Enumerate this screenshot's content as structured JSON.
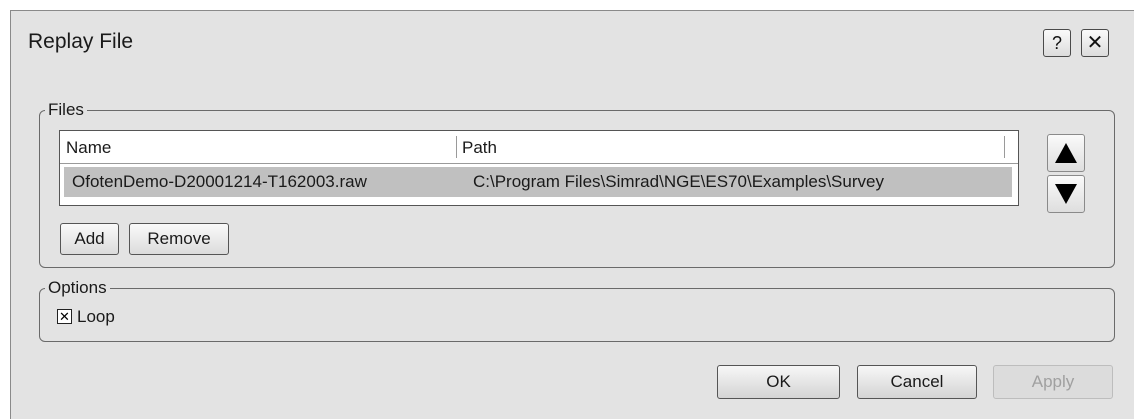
{
  "window": {
    "title": "Replay File",
    "help_label": "?",
    "close_label": "✕"
  },
  "files_group": {
    "label": "Files",
    "columns": {
      "name": "Name",
      "path": "Path"
    },
    "rows": [
      {
        "name": "OfotenDemo-D20001214-T162003.raw",
        "path": "C:\\Program Files\\Simrad\\NGE\\ES70\\Examples\\Survey",
        "selected": true
      }
    ],
    "add_label": "Add",
    "remove_label": "Remove",
    "move_up_icon": "triangle-up-icon",
    "move_down_icon": "triangle-down-icon"
  },
  "options_group": {
    "label": "Options",
    "loop": {
      "label": "Loop",
      "checked": true,
      "mark": "✕"
    }
  },
  "buttons": {
    "ok": "OK",
    "cancel": "Cancel",
    "apply": "Apply",
    "apply_enabled": false
  },
  "colors": {
    "dialog_bg": "#e3e3e3",
    "selected_row": "#c0c0c0",
    "disabled_text": "#a0a0a0"
  }
}
